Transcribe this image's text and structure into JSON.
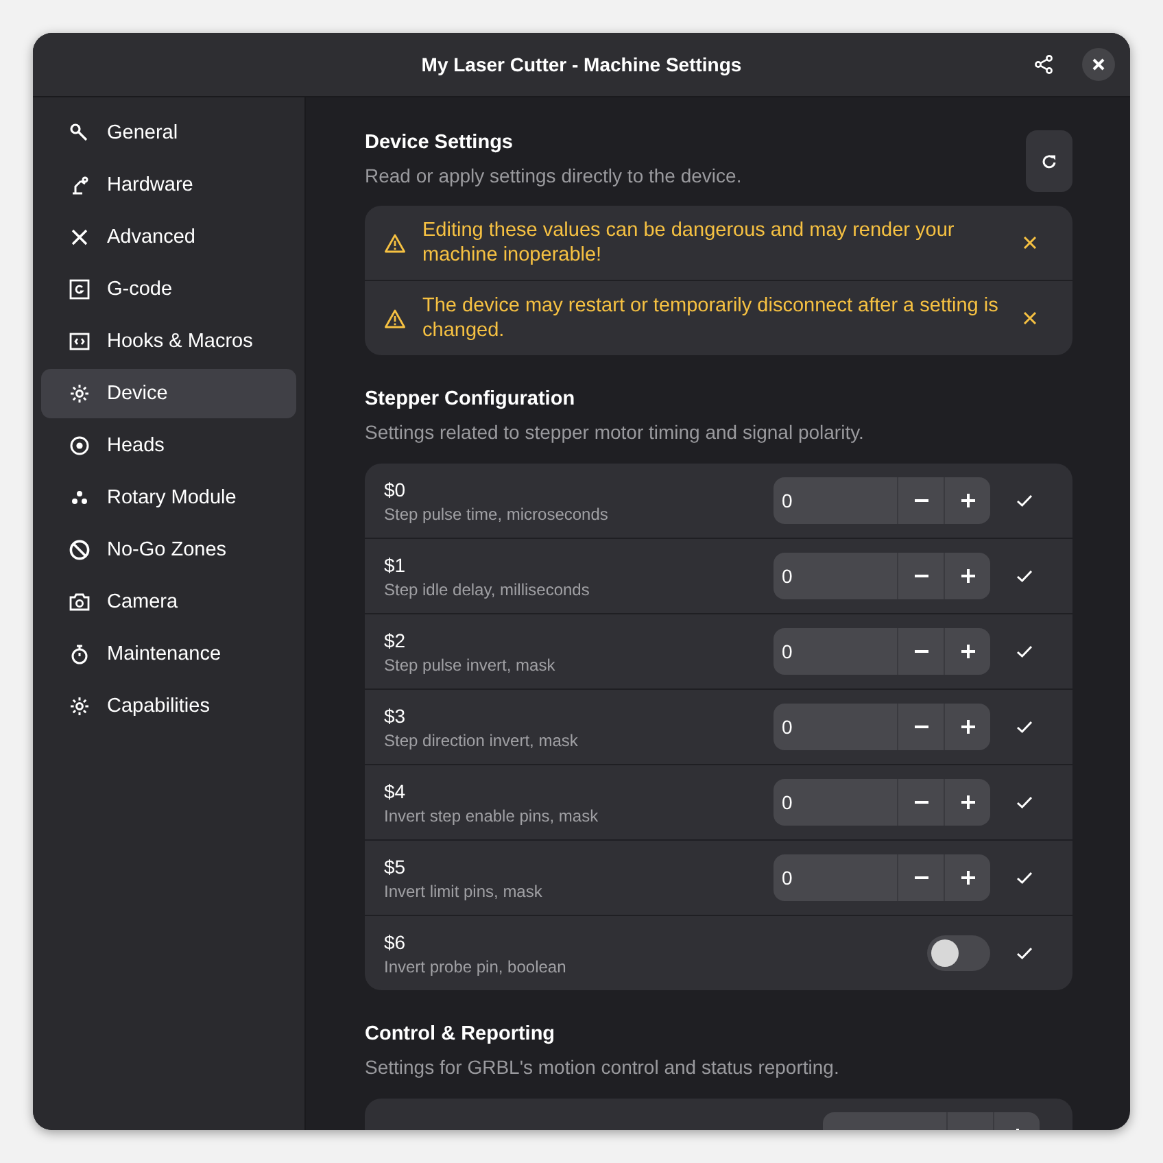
{
  "window": {
    "title": "My Laser Cutter - Machine Settings"
  },
  "sidebar": {
    "items": [
      {
        "label": "General",
        "selected": false
      },
      {
        "label": "Hardware",
        "selected": false
      },
      {
        "label": "Advanced",
        "selected": false
      },
      {
        "label": "G-code",
        "selected": false
      },
      {
        "label": "Hooks & Macros",
        "selected": false
      },
      {
        "label": "Device",
        "selected": true
      },
      {
        "label": "Heads",
        "selected": false
      },
      {
        "label": "Rotary Module",
        "selected": false
      },
      {
        "label": "No-Go Zones",
        "selected": false
      },
      {
        "label": "Camera",
        "selected": false
      },
      {
        "label": "Maintenance",
        "selected": false
      },
      {
        "label": "Capabilities",
        "selected": false
      }
    ]
  },
  "header": {
    "title": "Device Settings",
    "subtitle": "Read or apply settings directly to the device."
  },
  "alerts": [
    "Editing these values can be dangerous and may render your machine inoperable!",
    "The device may restart or temporarily disconnect after a setting is changed."
  ],
  "sections": [
    {
      "title": "Stepper Configuration",
      "subtitle": "Settings related to stepper motor timing and signal polarity.",
      "rows": [
        {
          "kind": "spin",
          "name": "$0",
          "description": "Step pulse time, microseconds",
          "value": "0"
        },
        {
          "kind": "spin",
          "name": "$1",
          "description": "Step idle delay, milliseconds",
          "value": "0"
        },
        {
          "kind": "spin",
          "name": "$2",
          "description": "Step pulse invert, mask",
          "value": "0"
        },
        {
          "kind": "spin",
          "name": "$3",
          "description": "Step direction invert, mask",
          "value": "0"
        },
        {
          "kind": "spin",
          "name": "$4",
          "description": "Invert step enable pins, mask",
          "value": "0"
        },
        {
          "kind": "spin",
          "name": "$5",
          "description": "Invert limit pins, mask",
          "value": "0"
        },
        {
          "kind": "switch",
          "name": "$6",
          "description": "Invert probe pin, boolean",
          "on": false
        }
      ]
    },
    {
      "title": "Control & Reporting",
      "subtitle": "Settings for GRBL's motion control and status reporting.",
      "rows": [
        {
          "kind": "spin"
        }
      ]
    }
  ]
}
